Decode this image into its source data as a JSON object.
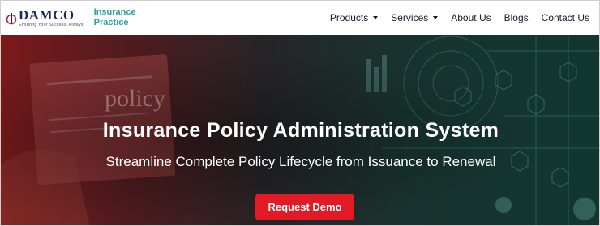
{
  "brand": {
    "name": "DAMCO",
    "tagline": "Ensuring Your Success. Always",
    "practice_line1": "Insurance",
    "practice_line2": "Practice",
    "accent_color": "#2aa39e",
    "brand_color": "#1c2a5a"
  },
  "nav": {
    "items": [
      {
        "label": "Products",
        "has_dropdown": true
      },
      {
        "label": "Services",
        "has_dropdown": true
      },
      {
        "label": "About Us",
        "has_dropdown": false
      },
      {
        "label": "Blogs",
        "has_dropdown": false
      },
      {
        "label": "Contact Us",
        "has_dropdown": false
      }
    ]
  },
  "hero": {
    "background_word": "policy",
    "title": "Insurance Policy Administration System",
    "subtitle": "Streamline Complete Policy Lifecycle from Issuance to Renewal",
    "cta_label": "Request Demo",
    "cta_color": "#e21a26"
  }
}
